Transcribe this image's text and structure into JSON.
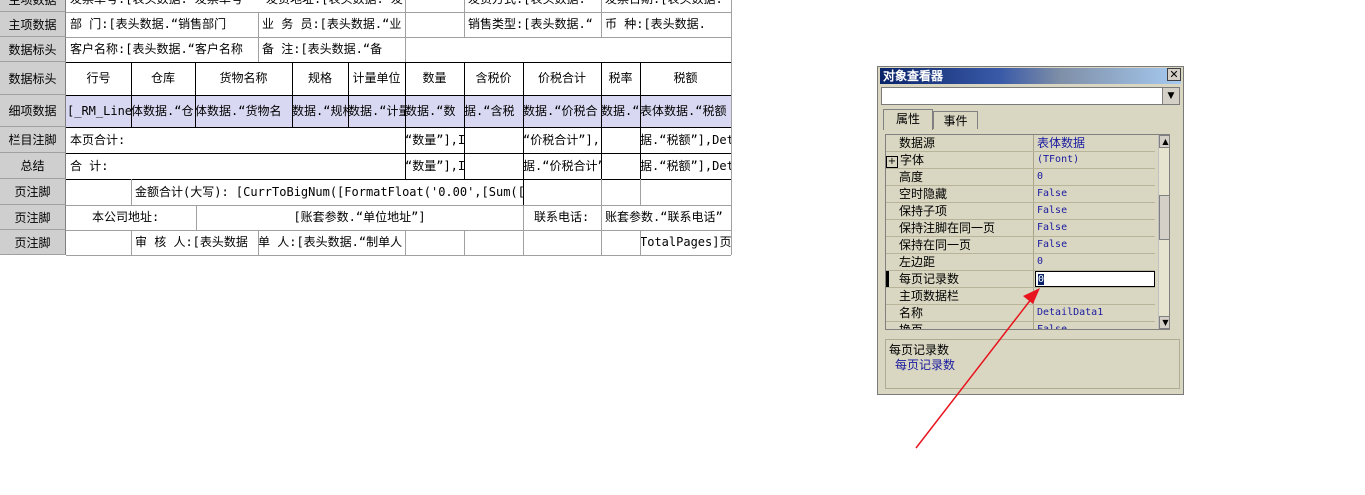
{
  "report": {
    "rows": [
      {
        "label": "主项数据",
        "cells": [
          "发票单号:[表头数据.“发票单号",
          "发货地址:[表头数据.“发往地址",
          "",
          "发货方式:[表头数据.“",
          "发票日期:[表头数据."
        ]
      },
      {
        "label": "主项数据",
        "cells": [
          "部    门:[表头数据.“销售部门",
          "业 务 员:[表头数据.“业",
          "",
          "销售类型:[表头数据.“",
          "币    种:[表头数据."
        ]
      },
      {
        "label": "数据标头",
        "cells": [
          "客户名称:[表头数据.“客户名称",
          "备    注:[表头数据.“备"
        ]
      },
      {
        "label": "数据标头",
        "cells": [
          "行号",
          "仓库",
          "货物名称",
          "规格",
          "计量单位",
          "数量",
          "含税价",
          "价税合计",
          "税率",
          "税额"
        ]
      },
      {
        "label": "细项数据",
        "cells": [
          "[_RM_Line",
          "体数据.“仓",
          "体数据.“货物名",
          "数据.“规格",
          "数据.“计量",
          "数据.“数",
          "据.“含税",
          "数据.“价税合",
          "数据.“",
          "表体数据.“税额"
        ]
      },
      {
        "label": "栏目注脚",
        "cells": [
          "本页合计:",
          "“数量”],I",
          "“价税合计”],",
          "据.“税额”],Det"
        ]
      },
      {
        "label": "总结",
        "cells": [
          "合      计:",
          "“数量”],I",
          "据.“价税合计”",
          "据.“税额”],Det"
        ]
      },
      {
        "label": "页注脚",
        "cells": [
          "金额合计(大写): [CurrToBigNum([FormatFloat('0.00',[Sum(["
        ]
      },
      {
        "label": "页注脚",
        "cells": [
          "本公司地址:",
          "[账套参数.“单位地址”]",
          "联系电话:",
          "账套参数.“联系电话”"
        ]
      },
      {
        "label": "页注脚",
        "cells": [
          "审 核 人:[表头数据",
          "单 人:[表头数据.“制单人",
          "TotalPages]页"
        ]
      }
    ]
  },
  "inspector": {
    "title": "对象查看器",
    "close": "✕",
    "combo_value": "",
    "tabs": [
      "属性",
      "事件"
    ],
    "properties": [
      {
        "name": "数据源",
        "value": "表体数据",
        "expand": ""
      },
      {
        "name": "字体",
        "value": "(TFont)",
        "expand": "+"
      },
      {
        "name": "高度",
        "value": "0",
        "expand": ""
      },
      {
        "name": "空时隐藏",
        "value": "False",
        "expand": ""
      },
      {
        "name": "保持子项",
        "value": "False",
        "expand": ""
      },
      {
        "name": "保持注脚在同一页",
        "value": "False",
        "expand": ""
      },
      {
        "name": "保持在同一页",
        "value": "False",
        "expand": ""
      },
      {
        "name": "左边距",
        "value": "0",
        "expand": ""
      },
      {
        "name": "每页记录数",
        "value": "0",
        "expand": ""
      },
      {
        "name": "主项数据栏",
        "value": "",
        "expand": ""
      },
      {
        "name": "名称",
        "value": "DetailData1",
        "expand": ""
      },
      {
        "name": "换页",
        "value": "False",
        "expand": ""
      }
    ],
    "description": {
      "title": "每页记录数",
      "body": "每页记录数"
    }
  },
  "colors": {
    "arrow": "#e8141e",
    "detail_band": "#d8d8f2",
    "inspector_bg": "#d9d7c2"
  }
}
